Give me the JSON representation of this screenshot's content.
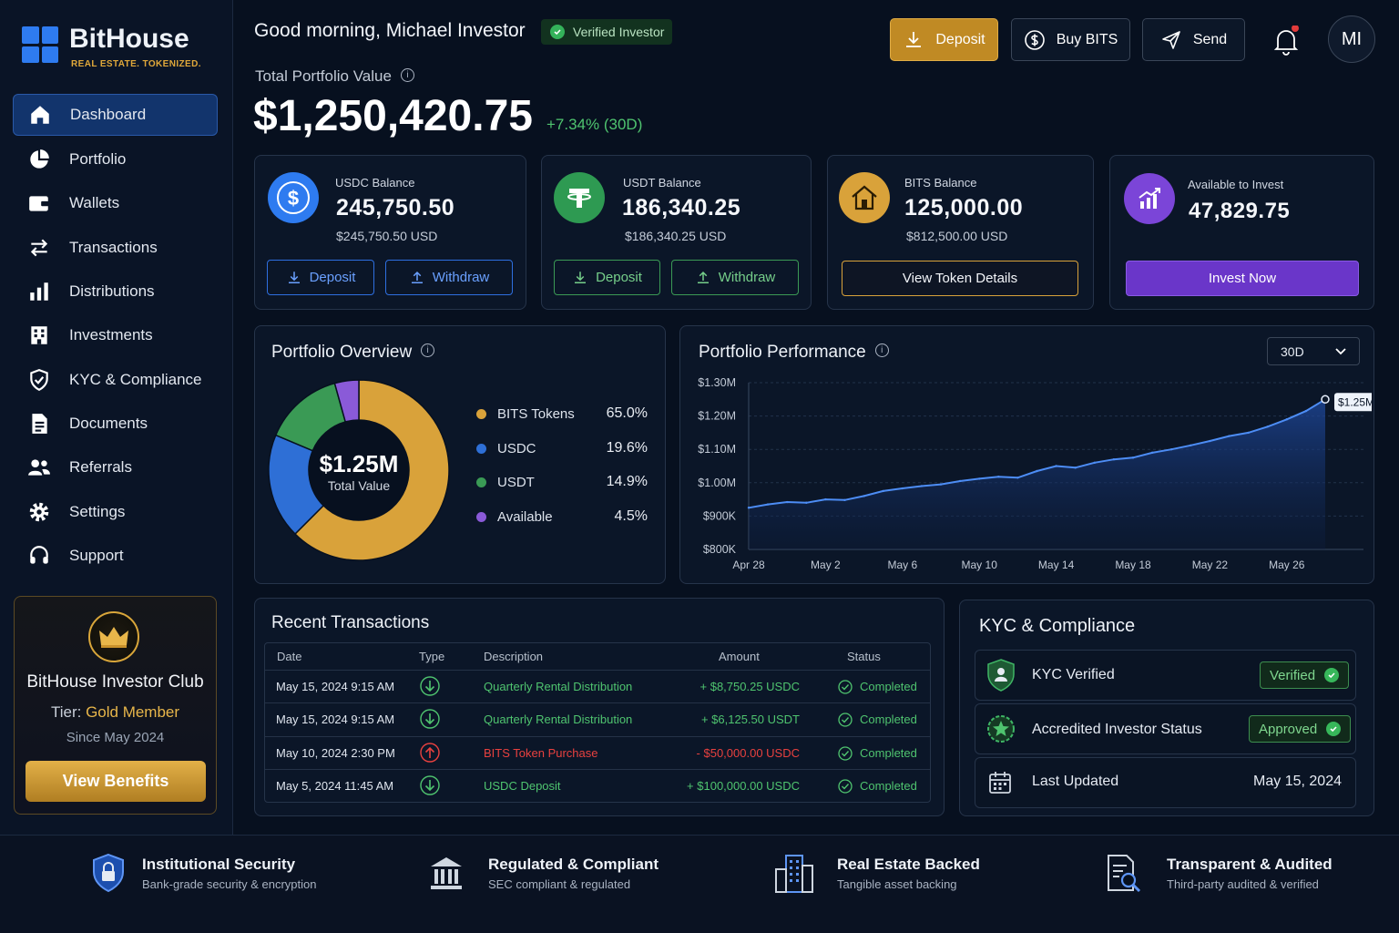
{
  "brand": {
    "name": "BitHouse",
    "tagline": "REAL ESTATE. TOKENIZED.",
    "accent": "#2e7bf0",
    "gold": "#e0a83a"
  },
  "sidebar": {
    "items": [
      {
        "label": "Dashboard",
        "icon": "home-icon",
        "active": true
      },
      {
        "label": "Portfolio",
        "icon": "pie-icon"
      },
      {
        "label": "Wallets",
        "icon": "wallet-icon"
      },
      {
        "label": "Transactions",
        "icon": "arrows-icon"
      },
      {
        "label": "Distributions",
        "icon": "bars-icon"
      },
      {
        "label": "Investments",
        "icon": "building-icon"
      },
      {
        "label": "KYC & Compliance",
        "icon": "shield-icon"
      },
      {
        "label": "Documents",
        "icon": "document-icon"
      },
      {
        "label": "Referrals",
        "icon": "users-icon"
      },
      {
        "label": "Settings",
        "icon": "gear-icon"
      },
      {
        "label": "Support",
        "icon": "headset-icon"
      }
    ],
    "club": {
      "title": "BitHouse Investor Club",
      "tier_label": "Tier:",
      "tier": "Gold Member",
      "since": "Since May 2024",
      "button": "View Benefits"
    }
  },
  "header": {
    "greeting": "Good morning, Michael Investor",
    "verified_badge": "Verified Investor",
    "portfolio_label": "Total Portfolio Value",
    "portfolio_value": "$1,250,420.75",
    "portfolio_change": "+7.34%  (30D)",
    "buttons": {
      "deposit": "Deposit",
      "buy": "Buy BITS",
      "send": "Send"
    },
    "avatar_initials": "MI",
    "has_notification": true
  },
  "cards": [
    {
      "label": "USDC Balance",
      "value": "245,750.50",
      "sub": "$245,750.50 USD",
      "btn1": "Deposit",
      "btn2": "Withdraw",
      "color": "#2e7bf0"
    },
    {
      "label": "USDT Balance",
      "value": "186,340.25",
      "sub": "$186,340.25 USD",
      "btn1": "Deposit",
      "btn2": "Withdraw",
      "color": "#2e9a52"
    },
    {
      "label": "BITS Balance",
      "value": "125,000.00",
      "sub": "$812,500.00 USD",
      "btn1": "View Token Details",
      "color": "#d9a23a"
    },
    {
      "label": "Available to Invest",
      "value": "47,829.75",
      "btn1": "Invest Now",
      "color": "#7b45d8"
    }
  ],
  "overview": {
    "title": "Portfolio Overview",
    "center_value": "$1.25M",
    "center_label": "Total Value",
    "legend": [
      {
        "name": "BITS Tokens",
        "pct": "65.0%",
        "value": 65.0,
        "color": "#d9a23a"
      },
      {
        "name": "USDC",
        "pct": "19.6%",
        "value": 19.6,
        "color": "#2e6fd6"
      },
      {
        "name": "USDT",
        "pct": "14.9%",
        "value": 14.9,
        "color": "#3a9a55"
      },
      {
        "name": "Available",
        "pct": "4.5%",
        "value": 4.5,
        "color": "#8a5ad8"
      }
    ]
  },
  "performance": {
    "title": "Portfolio Performance",
    "range": "30D",
    "end_label": "$1.25M"
  },
  "chart_data": {
    "type": "area",
    "title": "Portfolio Performance",
    "yticks": [
      "$1.30M",
      "$1.20M",
      "$1.10M",
      "$1.00M",
      "$900K",
      "$800K"
    ],
    "ylim": [
      800000,
      1300000
    ],
    "xticks": [
      "Apr 28",
      "May 2",
      "May 6",
      "May 10",
      "May 14",
      "May 18",
      "May 22",
      "May 26"
    ],
    "x_dates": [
      "Apr 28",
      "Apr 29",
      "Apr 30",
      "May 1",
      "May 2",
      "May 3",
      "May 4",
      "May 5",
      "May 6",
      "May 7",
      "May 8",
      "May 9",
      "May 10",
      "May 11",
      "May 12",
      "May 13",
      "May 14",
      "May 15",
      "May 16",
      "May 17",
      "May 18",
      "May 19",
      "May 20",
      "May 21",
      "May 22",
      "May 23",
      "May 24",
      "May 25",
      "May 26",
      "May 27",
      "May 28"
    ],
    "values": [
      925000,
      935000,
      942000,
      940000,
      950000,
      948000,
      960000,
      975000,
      983000,
      990000,
      995000,
      1005000,
      1012000,
      1018000,
      1015000,
      1035000,
      1050000,
      1045000,
      1060000,
      1070000,
      1075000,
      1090000,
      1100000,
      1112000,
      1125000,
      1140000,
      1150000,
      1168000,
      1190000,
      1215000,
      1250000
    ],
    "grid": true
  },
  "transactions": {
    "title": "Recent Transactions",
    "headers": [
      "Date",
      "Type",
      "Description",
      "Amount",
      "Status"
    ],
    "rows": [
      {
        "date": "May 15, 2024  9:15 AM",
        "dir": "in",
        "desc": "Quarterly Rental Distribution",
        "amount": "+ $8,750.25  USDC",
        "status": "Completed"
      },
      {
        "date": "May 15, 2024  9:15 AM",
        "dir": "in",
        "desc": "Quarterly Rental Distribution",
        "amount": "+ $6,125.50  USDT",
        "status": "Completed"
      },
      {
        "date": "May 10, 2024  2:30 PM",
        "dir": "out",
        "desc": "BITS Token Purchase",
        "amount": "- $50,000.00  USDC",
        "status": "Completed"
      },
      {
        "date": "May 5, 2024  11:45 AM",
        "dir": "in",
        "desc": "USDC Deposit",
        "amount": "+ $100,000.00  USDC",
        "status": "Completed"
      }
    ]
  },
  "kyc": {
    "title": "KYC & Compliance",
    "rows": [
      {
        "label": "KYC Verified",
        "badge": "Verified"
      },
      {
        "label": "Accredited Investor Status",
        "badge": "Approved"
      },
      {
        "label": "Last Updated",
        "value": "May 15, 2024"
      }
    ]
  },
  "footer": [
    {
      "title": "Institutional Security",
      "sub": "Bank-grade security & encryption"
    },
    {
      "title": "Regulated & Compliant",
      "sub": "SEC compliant & regulated"
    },
    {
      "title": "Real Estate Backed",
      "sub": "Tangible asset backing"
    },
    {
      "title": "Transparent & Audited",
      "sub": "Third-party audited & verified"
    }
  ]
}
